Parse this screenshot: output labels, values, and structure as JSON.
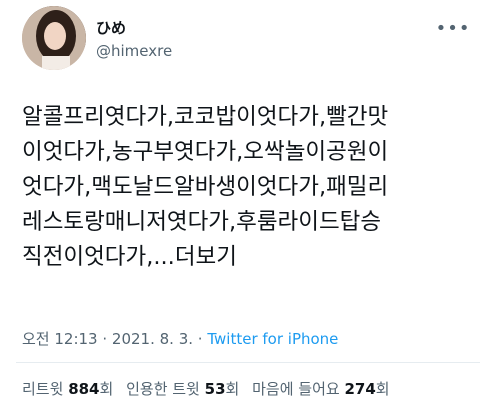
{
  "user": {
    "display_name": "ひめ",
    "handle": "@himexre",
    "avatar_icon": "profile-photo"
  },
  "more_icon": "ellipsis-icon",
  "tweet": {
    "text": "알콜프리엿다가,코코밥이엇다가,빨간맛\n이엇다가,농구부엿다가,오싹놀이공원이\n엇다가,맥도날드알바생이엇다가,패밀리\n레스토랑매니저엿다가,후룸라이드탑승\n직전이엇다가,...",
    "more_label": "더보기"
  },
  "meta": {
    "time": "오전 12:13",
    "separator": " · ",
    "date": "2021. 8. 3.",
    "source": "Twitter for iPhone"
  },
  "stats": {
    "retweets_label": "리트윗",
    "retweets_count": "884",
    "retweets_unit": "회",
    "quotes_label": "인용한 트윗",
    "quotes_count": "53",
    "quotes_unit": "회",
    "likes_label": "마음에 들어요",
    "likes_count": "274",
    "likes_unit": "회"
  },
  "colors": {
    "link": "#1d9bf0",
    "secondary_text": "#536471",
    "primary_text": "#0f1419"
  }
}
